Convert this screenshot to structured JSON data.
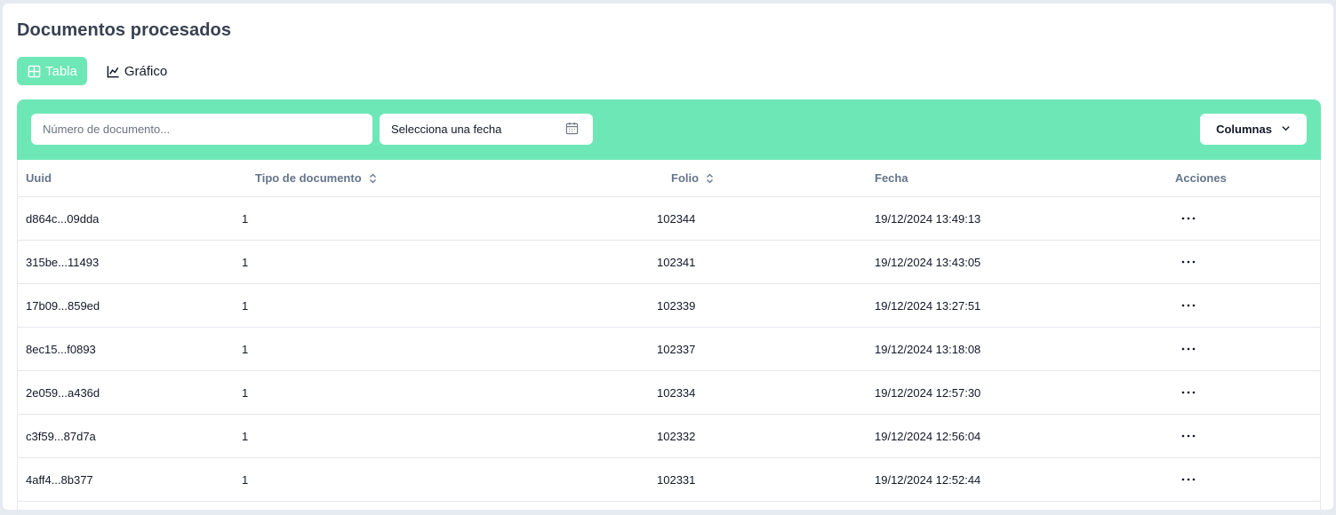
{
  "page": {
    "title": "Documentos procesados"
  },
  "view_tabs": [
    {
      "label": "Tabla",
      "icon": "table-icon",
      "active": true
    },
    {
      "label": "Gráfico",
      "icon": "chart-icon",
      "active": false
    }
  ],
  "filters": {
    "document_number": {
      "placeholder": "Número de documento...",
      "value": ""
    },
    "date_picker": {
      "label": "Selecciona una fecha",
      "icon": "calendar-icon"
    },
    "columns_button": {
      "label": "Columnas",
      "icon": "chevron-down-icon"
    }
  },
  "table": {
    "columns": [
      "Uuid",
      "Tipo de documento",
      "Folio",
      "Fecha",
      "Acciones"
    ],
    "sortable": [
      "Tipo de documento",
      "Folio"
    ],
    "rows": [
      {
        "uuid": "d864c...09dda",
        "tipo": "1",
        "folio": "102344",
        "fecha": "19/12/2024 13:49:13"
      },
      {
        "uuid": "315be...11493",
        "tipo": "1",
        "folio": "102341",
        "fecha": "19/12/2024 13:43:05"
      },
      {
        "uuid": "17b09...859ed",
        "tipo": "1",
        "folio": "102339",
        "fecha": "19/12/2024 13:27:51"
      },
      {
        "uuid": "8ec15...f0893",
        "tipo": "1",
        "folio": "102337",
        "fecha": "19/12/2024 13:18:08"
      },
      {
        "uuid": "2e059...a436d",
        "tipo": "1",
        "folio": "102334",
        "fecha": "19/12/2024 12:57:30"
      },
      {
        "uuid": "c3f59...87d7a",
        "tipo": "1",
        "folio": "102332",
        "fecha": "19/12/2024 12:56:04"
      },
      {
        "uuid": "4aff4...8b377",
        "tipo": "1",
        "folio": "102331",
        "fecha": "19/12/2024 12:52:44"
      }
    ]
  },
  "colors": {
    "accent": "#6ee7b7",
    "background": "#e6ebf1",
    "header_text": "#64748b"
  }
}
